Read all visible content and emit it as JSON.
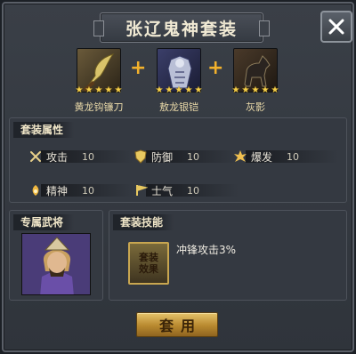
{
  "title": "张辽鬼神套装",
  "equipment": [
    {
      "name": "黄龙钩镰刀",
      "stars": 5,
      "icon": "blade-icon"
    },
    {
      "name": "敖龙银铠",
      "stars": 5,
      "icon": "armor-icon"
    },
    {
      "name": "灰影",
      "stars": 5,
      "icon": "horse-icon"
    }
  ],
  "sections": {
    "attrs_title": "套装属性",
    "general_title": "专属武将",
    "skill_title": "套装技能"
  },
  "attributes": [
    {
      "label": "攻击",
      "value": "10",
      "icon": "crossed-swords-icon"
    },
    {
      "label": "防御",
      "value": "10",
      "icon": "shield-icon"
    },
    {
      "label": "爆发",
      "value": "10",
      "icon": "burst-icon"
    },
    {
      "label": "精神",
      "value": "10",
      "icon": "spirit-icon"
    },
    {
      "label": "士气",
      "value": "10",
      "icon": "morale-icon"
    }
  ],
  "skill": {
    "icon_line1": "套装",
    "icon_line2": "效果",
    "description": "冲锋攻击3%"
  },
  "apply_label": "套用",
  "colors": {
    "accent": "#f2b12c",
    "star": "#f5d04a",
    "button": "#d3a94a"
  }
}
